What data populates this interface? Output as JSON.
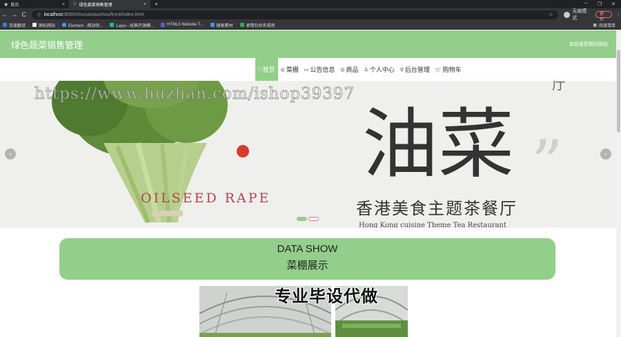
{
  "browser": {
    "tabs": [
      {
        "title": "首页",
        "active": false
      },
      {
        "title": "绿色蔬菜销售管理",
        "active": true
      }
    ],
    "new_tab": "+",
    "window_controls": [
      "─",
      "❐",
      "✕"
    ],
    "back": "←",
    "forward": "→",
    "reload": "C",
    "address_host": "localhost",
    "address_path": ":8080/shucaixiaoshou/front/index.html",
    "profile_label": "无痕模式",
    "update_label": "更新",
    "bookmarks": [
      {
        "label": "百度翻译",
        "color": "#3b7ddd"
      },
      {
        "label": "图标网站",
        "color": "#eeeeee"
      },
      {
        "label": "Element - 网站快...",
        "color": "#409eff"
      },
      {
        "label": "Layui - 经典开源模...",
        "color": "#16baaa"
      },
      {
        "label": "HTML5 Website T...",
        "color": "#5b5fc7"
      },
      {
        "label": "搜索素材",
        "color": "#4a90d9"
      },
      {
        "label": "表情包命名规则",
        "color": "#2eaa5a"
      }
    ],
    "reading_list": "阅读清单"
  },
  "header": {
    "title": "绿色蔬菜销售管理",
    "welcome": "欢迎来到我的网站"
  },
  "nav": [
    {
      "icon": "□",
      "label": "首页",
      "active": true,
      "icon_name": "home-icon"
    },
    {
      "icon": "◎",
      "label": "菜棚",
      "active": false,
      "icon_name": "greenhouse-icon"
    },
    {
      "icon": "▭",
      "label": "公告信息",
      "active": false,
      "icon_name": "notice-icon"
    },
    {
      "icon": "◎",
      "label": "商品",
      "active": false,
      "icon_name": "goods-icon"
    },
    {
      "icon": "♙",
      "label": "个人中心",
      "active": false,
      "icon_name": "user-icon"
    },
    {
      "icon": "⚲",
      "label": "后台管理",
      "active": false,
      "icon_name": "link-icon"
    },
    {
      "icon": "🛒",
      "label": "购物车",
      "active": false,
      "icon_name": "cart-icon"
    }
  ],
  "banner": {
    "watermark": "https://www.huzhan.com/ishop39397",
    "big_text": "油菜",
    "en_text": "OILSEED RAPE",
    "cn_subtitle": "香港美食主题茶餐厅",
    "en_subtitle": "Hong Kong cuisine Theme Tea Restaurant",
    "corner_char": "厅",
    "prev": "‹",
    "next": "›",
    "dots": 2,
    "active_dot": 0
  },
  "section": {
    "title_en": "DATA SHOW",
    "title_cn": "菜棚展示"
  },
  "overlay_text": "专业毕设代做"
}
